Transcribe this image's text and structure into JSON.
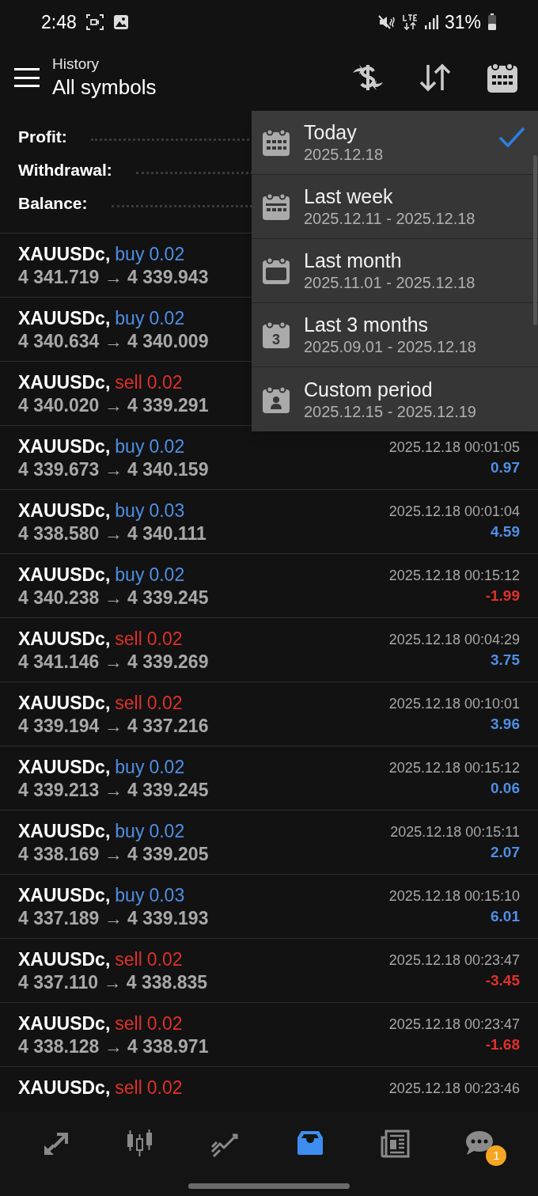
{
  "status_bar": {
    "time": "2:48",
    "battery": "31%"
  },
  "header": {
    "subtitle": "History",
    "title": "All symbols"
  },
  "summary": [
    {
      "label": "Profit:"
    },
    {
      "label": "Withdrawal:"
    },
    {
      "label": "Balance:"
    }
  ],
  "deals": [
    {
      "symbol": "XAUUSDc,",
      "type": "buy",
      "volume": "0.02",
      "prices": "4 341.719 → 4 339.943"
    },
    {
      "symbol": "XAUUSDc,",
      "type": "buy",
      "volume": "0.02",
      "prices": "4 340.634 → 4 340.009"
    },
    {
      "symbol": "XAUUSDc,",
      "type": "sell",
      "volume": "0.02",
      "prices": "4 340.020 → 4 339.291"
    },
    {
      "symbol": "XAUUSDc,",
      "type": "buy",
      "volume": "0.02",
      "prices": "4 339.673 → 4 340.159",
      "time": "2025.12.18 00:01:05",
      "profit": "0.97",
      "loss": false
    },
    {
      "symbol": "XAUUSDc,",
      "type": "buy",
      "volume": "0.03",
      "prices": "4 338.580 → 4 340.111",
      "time": "2025.12.18 00:01:04",
      "profit": "4.59",
      "loss": false
    },
    {
      "symbol": "XAUUSDc,",
      "type": "buy",
      "volume": "0.02",
      "prices": "4 340.238 → 4 339.245",
      "time": "2025.12.18 00:15:12",
      "profit": "-1.99",
      "loss": true
    },
    {
      "symbol": "XAUUSDc,",
      "type": "sell",
      "volume": "0.02",
      "prices": "4 341.146 → 4 339.269",
      "time": "2025.12.18 00:04:29",
      "profit": "3.75",
      "loss": false
    },
    {
      "symbol": "XAUUSDc,",
      "type": "sell",
      "volume": "0.02",
      "prices": "4 339.194 → 4 337.216",
      "time": "2025.12.18 00:10:01",
      "profit": "3.96",
      "loss": false
    },
    {
      "symbol": "XAUUSDc,",
      "type": "buy",
      "volume": "0.02",
      "prices": "4 339.213 → 4 339.245",
      "time": "2025.12.18 00:15:12",
      "profit": "0.06",
      "loss": false
    },
    {
      "symbol": "XAUUSDc,",
      "type": "buy",
      "volume": "0.02",
      "prices": "4 338.169 → 4 339.205",
      "time": "2025.12.18 00:15:11",
      "profit": "2.07",
      "loss": false
    },
    {
      "symbol": "XAUUSDc,",
      "type": "buy",
      "volume": "0.03",
      "prices": "4 337.189 → 4 339.193",
      "time": "2025.12.18 00:15:10",
      "profit": "6.01",
      "loss": false
    },
    {
      "symbol": "XAUUSDc,",
      "type": "sell",
      "volume": "0.02",
      "prices": "4 337.110 → 4 338.835",
      "time": "2025.12.18 00:23:47",
      "profit": "-3.45",
      "loss": true
    },
    {
      "symbol": "XAUUSDc,",
      "type": "sell",
      "volume": "0.02",
      "prices": "4 338.128 → 4 338.971",
      "time": "2025.12.18 00:23:47",
      "profit": "-1.68",
      "loss": true
    },
    {
      "symbol": "XAUUSDc,",
      "type": "sell",
      "volume": "0.02",
      "time": "2025.12.18 00:23:46"
    }
  ],
  "period_menu": [
    {
      "kind": "day",
      "label": "Today",
      "range": "2025.12.18",
      "selected": true
    },
    {
      "kind": "week",
      "label": "Last week",
      "range": "2025.12.11 - 2025.12.18",
      "selected": false
    },
    {
      "kind": "month",
      "label": "Last month",
      "range": "2025.11.01 - 2025.12.18",
      "selected": false
    },
    {
      "kind": "quarter",
      "label": "Last 3 months",
      "icon_text": "3",
      "range": "2025.09.01 - 2025.12.18",
      "selected": false
    },
    {
      "kind": "custom",
      "label": "Custom period",
      "range": "2025.12.15 - 2025.12.19",
      "selected": false
    }
  ],
  "nav": [
    {
      "kind": "trade",
      "selected": false
    },
    {
      "kind": "chart",
      "selected": false
    },
    {
      "kind": "quotes",
      "selected": false
    },
    {
      "kind": "history",
      "selected": true
    },
    {
      "kind": "news",
      "selected": false
    },
    {
      "kind": "chat",
      "selected": false,
      "badge": "1"
    }
  ]
}
